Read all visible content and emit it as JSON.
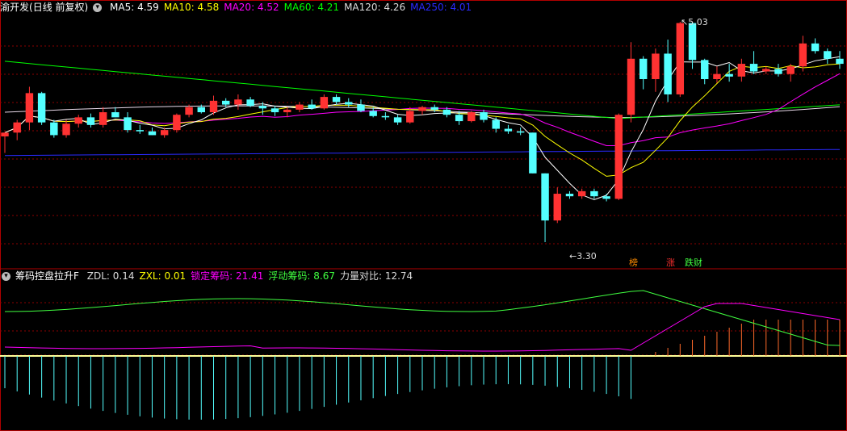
{
  "price_panel": {
    "stock_name": "渝开发",
    "period_label": "(日线 前复权)",
    "dropdown_icon": "chevron-down-icon",
    "ma": [
      {
        "label": "MA5: 4.59",
        "color": "#ffffff"
      },
      {
        "label": "MA10: 4.58",
        "color": "#ffff00"
      },
      {
        "label": "MA20: 4.52",
        "color": "#ff00ff"
      },
      {
        "label": "MA60: 4.21",
        "color": "#00ff00"
      },
      {
        "label": "MA120: 4.26",
        "color": "#dddddd"
      },
      {
        "label": "MA250: 4.01",
        "color": "#2a2aff"
      }
    ],
    "high_label": "5.03",
    "low_label": "3.30",
    "tags": [
      {
        "text": "榜",
        "color": "#ff8c00"
      },
      {
        "text": "涨",
        "color": "#ff3030"
      },
      {
        "text": "跌财",
        "color": "#40ff40"
      }
    ]
  },
  "indicator_panel": {
    "name": "筹码控盘拉升F",
    "values": [
      {
        "label": "ZDL: 0.14",
        "color": "#dddddd"
      },
      {
        "label": "ZXL: 0.01",
        "color": "#ffff00"
      },
      {
        "label": "锁定筹码: 21.41",
        "color": "#ff00ff"
      },
      {
        "label": "浮动筹码: 8.67",
        "color": "#40ff40"
      },
      {
        "label": "力量对比: 12.74",
        "color": "#dddddd"
      }
    ]
  },
  "colors": {
    "up": "#ff3232",
    "down": "#54ffff",
    "grid": "#8b0000",
    "border": "#b00000"
  },
  "chart_data": {
    "type": "candlestick",
    "price_range": [
      3.3,
      5.03
    ],
    "candles": [
      [
        4.13,
        4.16,
        4.0,
        4.16
      ],
      [
        4.16,
        4.26,
        4.1,
        4.24
      ],
      [
        4.24,
        4.52,
        4.18,
        4.47
      ],
      [
        4.47,
        4.48,
        4.22,
        4.24
      ],
      [
        4.24,
        4.26,
        4.12,
        4.14
      ],
      [
        4.14,
        4.26,
        4.12,
        4.23
      ],
      [
        4.23,
        4.3,
        4.2,
        4.28
      ],
      [
        4.28,
        4.31,
        4.2,
        4.22
      ],
      [
        4.22,
        4.36,
        4.2,
        4.32
      ],
      [
        4.32,
        4.36,
        4.28,
        4.28
      ],
      [
        4.28,
        4.32,
        4.16,
        4.18
      ],
      [
        4.18,
        4.22,
        4.15,
        4.17
      ],
      [
        4.17,
        4.2,
        4.14,
        4.14
      ],
      [
        4.14,
        4.2,
        4.12,
        4.18
      ],
      [
        4.18,
        4.31,
        4.16,
        4.3
      ],
      [
        4.3,
        4.38,
        4.28,
        4.36
      ],
      [
        4.36,
        4.38,
        4.31,
        4.32
      ],
      [
        4.32,
        4.45,
        4.3,
        4.41
      ],
      [
        4.41,
        4.43,
        4.36,
        4.38
      ],
      [
        4.38,
        4.46,
        4.34,
        4.42
      ],
      [
        4.42,
        4.44,
        4.36,
        4.37
      ],
      [
        4.37,
        4.4,
        4.3,
        4.35
      ],
      [
        4.35,
        4.37,
        4.29,
        4.32
      ],
      [
        4.32,
        4.36,
        4.28,
        4.34
      ],
      [
        4.34,
        4.4,
        4.32,
        4.38
      ],
      [
        4.38,
        4.42,
        4.34,
        4.35
      ],
      [
        4.35,
        4.46,
        4.34,
        4.44
      ],
      [
        4.44,
        4.46,
        4.38,
        4.4
      ],
      [
        4.4,
        4.43,
        4.36,
        4.38
      ],
      [
        4.38,
        4.42,
        4.32,
        4.33
      ],
      [
        4.33,
        4.36,
        4.28,
        4.29
      ],
      [
        4.29,
        4.32,
        4.26,
        4.28
      ],
      [
        4.28,
        4.3,
        4.22,
        4.24
      ],
      [
        4.24,
        4.36,
        4.23,
        4.33
      ],
      [
        4.33,
        4.37,
        4.3,
        4.36
      ],
      [
        4.36,
        4.38,
        4.32,
        4.34
      ],
      [
        4.34,
        4.36,
        4.28,
        4.3
      ],
      [
        4.3,
        4.33,
        4.22,
        4.25
      ],
      [
        4.25,
        4.33,
        4.24,
        4.32
      ],
      [
        4.32,
        4.34,
        4.24,
        4.26
      ],
      [
        4.26,
        4.28,
        4.16,
        4.19
      ],
      [
        4.19,
        4.22,
        4.15,
        4.17
      ],
      [
        4.17,
        4.2,
        4.14,
        4.16
      ],
      [
        4.16,
        4.16,
        3.84,
        3.84
      ],
      [
        3.84,
        3.84,
        3.3,
        3.47
      ],
      [
        3.47,
        3.73,
        3.45,
        3.68
      ],
      [
        3.68,
        3.7,
        3.64,
        3.66
      ],
      [
        3.66,
        3.72,
        3.64,
        3.7
      ],
      [
        3.7,
        3.72,
        3.64,
        3.66
      ],
      [
        3.66,
        3.68,
        3.62,
        3.64
      ],
      [
        3.64,
        4.31,
        3.63,
        4.3
      ],
      [
        4.3,
        4.87,
        4.24,
        4.74
      ],
      [
        4.74,
        4.76,
        4.5,
        4.58
      ],
      [
        4.58,
        4.82,
        4.48,
        4.78
      ],
      [
        4.78,
        4.89,
        4.4,
        4.46
      ],
      [
        4.46,
        5.03,
        4.44,
        5.02
      ],
      [
        5.02,
        5.03,
        4.66,
        4.73
      ],
      [
        4.73,
        4.74,
        4.54,
        4.58
      ],
      [
        4.58,
        4.68,
        4.55,
        4.62
      ],
      [
        4.62,
        4.7,
        4.56,
        4.6
      ],
      [
        4.6,
        4.74,
        4.56,
        4.7
      ],
      [
        4.7,
        4.8,
        4.62,
        4.64
      ],
      [
        4.64,
        4.68,
        4.62,
        4.66
      ],
      [
        4.66,
        4.7,
        4.6,
        4.62
      ],
      [
        4.62,
        4.7,
        4.56,
        4.68
      ],
      [
        4.68,
        4.92,
        4.64,
        4.86
      ],
      [
        4.86,
        4.9,
        4.78,
        4.8
      ],
      [
        4.8,
        4.82,
        4.7,
        4.74
      ],
      [
        4.74,
        4.8,
        4.66,
        4.7
      ]
    ]
  }
}
